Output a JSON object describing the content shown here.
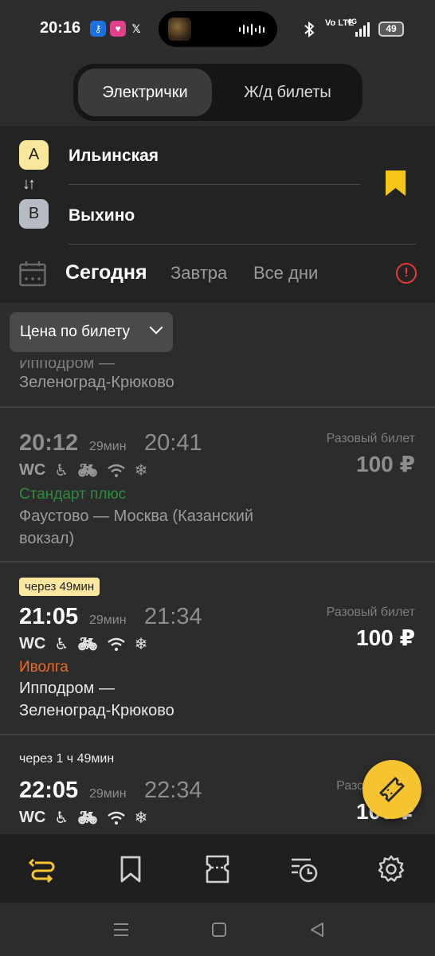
{
  "status_bar": {
    "time": "20:16",
    "app_icons": [
      "key-app-icon",
      "fitness-app-icon",
      "x-app-icon"
    ],
    "network": "4G",
    "volte": "Vo LTE",
    "battery": "49"
  },
  "tabs": {
    "active": "Электрички",
    "other": "Ж/д билеты"
  },
  "route": {
    "from_badge": "A",
    "from": "Ильинская",
    "to_badge": "B",
    "to": "Выхино"
  },
  "days": {
    "today": "Сегодня",
    "tomorrow": "Завтра",
    "all": "Все дни"
  },
  "filter": {
    "label": "Цена по билету"
  },
  "list": {
    "partial_top": {
      "line1": "Ипподром —",
      "line2": "Зеленоград-Крюково"
    },
    "items": [
      {
        "depart": "20:12",
        "duration": "29мин",
        "arrive": "20:41",
        "price_title": "Разовый билет",
        "price": "100 ₽",
        "amenity_wc": "WC",
        "category": "Стандарт плюс",
        "category_color": "#2e8b3b",
        "route": "Фаустово — Москва (Казанский вокзал)"
      },
      {
        "badge": "через 49мин",
        "depart": "21:05",
        "duration": "29мин",
        "arrive": "21:34",
        "price_title": "Разовый билет",
        "price": "100 ₽",
        "amenity_wc": "WC",
        "category": "Иволга",
        "category_color": "#f06a25",
        "route_line1": "Ипподром —",
        "route_line2": "Зеленоград-Крюково"
      },
      {
        "note": "через 1 ч 49мин",
        "depart": "22:05",
        "duration": "29мин",
        "arrive": "22:34",
        "price_title": "Разовый",
        "price": "100 ₽",
        "amenity_wc": "WC"
      }
    ]
  },
  "colors": {
    "accent": "#f7c431",
    "bookmark": "#f5c518",
    "alert": "#e53935"
  },
  "bottom_nav": [
    "routes-icon",
    "bookmark-icon",
    "ticket-icon",
    "history-icon",
    "settings-icon"
  ]
}
